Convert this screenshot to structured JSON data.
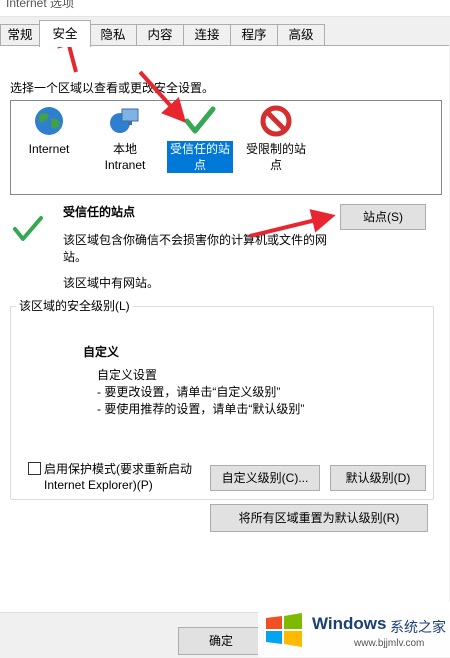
{
  "window": {
    "title": "Internet 选项"
  },
  "tabs": [
    "常规",
    "安全",
    "隐私",
    "内容",
    "连接",
    "程序",
    "高级"
  ],
  "zones": {
    "instruction": "选择一个区域以查看或更改安全设置。",
    "items": [
      {
        "label": "Internet",
        "icon": "globe-icon"
      },
      {
        "label": "本地\nIntranet",
        "icon": "intranet-icon"
      },
      {
        "label": "受信任的站\n点",
        "icon": "check-icon"
      },
      {
        "label": "受限制的站\n点",
        "icon": "restricted-icon"
      }
    ]
  },
  "selected_zone": {
    "title": "受信任的站点",
    "description": "该区域包含你确信不会损害你的计算机或文件的网站。",
    "status": "该区域中有网站。",
    "sites_button": "站点(S)"
  },
  "security_level": {
    "group_title": "该区域的安全级别(L)",
    "level": "自定义",
    "line1": "自定义设置",
    "line2": "- 要更改设置，请单击“自定义级别”",
    "line3": "- 要使用推荐的设置，请单击“默认级别”",
    "protected_mode": "启用保护模式(要求重新启动",
    "protected_mode_2": "Internet Explorer)(P)",
    "custom_level_button": "自定义级别(C)...",
    "default_level_button": "默认级别(D)",
    "reset_all_button": "将所有区域重置为默认级别(R)"
  },
  "footer": {
    "ok_button": "确定",
    "watermark_brand": "Windows",
    "watermark_text": "系统之家",
    "watermark_url": "www.bjjmlv.com"
  },
  "colors": {
    "selection": "#0078d7",
    "arrow": "#e8262f",
    "check": "#34a853"
  }
}
